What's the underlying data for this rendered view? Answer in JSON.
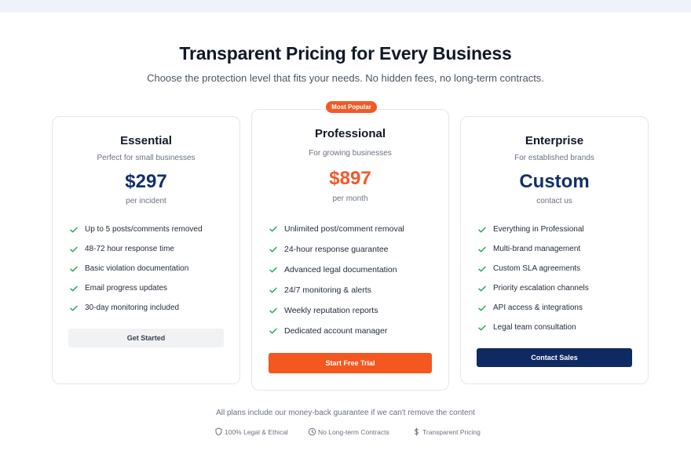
{
  "header": {
    "title": "Transparent Pricing for Every Business",
    "subtitle": "Choose the protection level that fits your needs. No hidden fees, no long-term contracts."
  },
  "plans": [
    {
      "name": "Essential",
      "description": "Perfect for small businesses",
      "price": "$297",
      "unit": "per incident",
      "features": [
        "Up to 5 posts/comments removed",
        "48-72 hour response time",
        "Basic violation documentation",
        "Email progress updates",
        "30-day monitoring included"
      ],
      "cta": "Get Started"
    },
    {
      "name": "Professional",
      "badge": "Most Popular",
      "description": "For growing businesses",
      "price": "$897",
      "unit": "per month",
      "features": [
        "Unlimited post/comment removal",
        "24-hour response guarantee",
        "Advanced legal documentation",
        "24/7 monitoring & alerts",
        "Weekly reputation reports",
        "Dedicated account manager"
      ],
      "cta": "Start Free Trial"
    },
    {
      "name": "Enterprise",
      "description": "For established brands",
      "price": "Custom",
      "unit": "contact us",
      "features": [
        "Everything in Professional",
        "Multi-brand management",
        "Custom SLA agreements",
        "Priority escalation channels",
        "API access & integrations",
        "Legal team consultation"
      ],
      "cta": "Contact Sales"
    }
  ],
  "footer": {
    "guarantee": "All plans include our money-back guarantee if we can't remove the content",
    "trust": [
      {
        "icon": "shield-icon",
        "label": "100% Legal & Ethical"
      },
      {
        "icon": "clock-icon",
        "label": "No Long-term Contracts"
      },
      {
        "icon": "dollar-icon",
        "label": "Transparent Pricing"
      }
    ]
  },
  "colors": {
    "accent": "#f05a28",
    "navy": "#12306b",
    "check": "#22a35a"
  }
}
